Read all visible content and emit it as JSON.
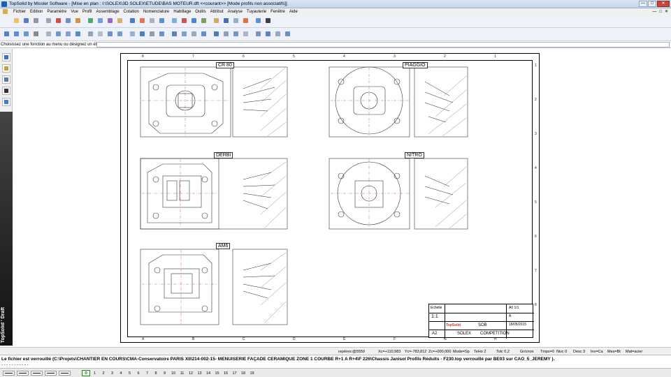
{
  "window": {
    "title": "TopSolid by Missler Software - [Mise en plan : I:\\SOLEX\\3D SOLEX\\ETUDE\\BAS MOTEUR.dft  <<courant>> [Mode profils non associatifs]]",
    "minimize": "—",
    "maximize": "□",
    "close": "✕"
  },
  "menu": {
    "items": [
      "Fichier",
      "Edition",
      "Paramètre",
      "Vue",
      "Profil",
      "Assemblage",
      "Cotation",
      "Nomenclature",
      "Habillage",
      "Outils",
      "Attribut",
      "Analyse",
      "Tuyauterie",
      "Fenêtre",
      "Aide"
    ],
    "right": [
      "—",
      "□",
      "✕"
    ]
  },
  "toolbar1": {
    "colors": [
      "#f2f2f2",
      "#e9b94b",
      "#3c67b8",
      "#7f8793",
      "#8f97a3",
      "#c8322b",
      "#5b7ec8",
      "#c9802a",
      "#2f9b5a",
      "#5e8fd6",
      "#8a4fb8",
      "#d4a64a",
      "#2e6cb5",
      "#e0602d",
      "#a0a8b4",
      "#3f7dd1",
      "#5da4e0",
      "#c23b35",
      "#2a74c4",
      "#6b8d3e",
      "#c5a048",
      "#2c58a5",
      "#8aa0c0",
      "#d95b2b",
      "#3a86c9",
      "#1f1f1f"
    ]
  },
  "toolbar2": {
    "colors": [
      "#2f6fc7",
      "#3d7fd2",
      "#4b8ad6",
      "#777",
      "#9aa7b9",
      "#5b87c5",
      "#6c93cc",
      "#3c78c6",
      "#8297b3",
      "#aab4c4",
      "#4d84c8",
      "#5f8dc9",
      "#8da6c7",
      "#2e6bb6",
      "#7b8fa8",
      "#5582c0",
      "#3f6fb3",
      "#6e8fbf",
      "#8a9cb5",
      "#4a7cc0",
      "#2f64ae",
      "#7a91b3",
      "#5c85bf",
      "#9aaec8",
      "#6383b8",
      "#3b72bd",
      "#8799b2",
      "#5080c3"
    ]
  },
  "prompt": {
    "text": "Choisissez une fonction au menu ou désignez un élément"
  },
  "sidebar": {
    "label": "TopSolid ' Draft"
  },
  "drawing": {
    "views": [
      {
        "label": "CR 80"
      },
      {
        "label": "PIAGGIO"
      },
      {
        "label": "DERBI"
      },
      {
        "label": "NITRO"
      },
      {
        "label": "AM6"
      }
    ],
    "top_ruler": [
      "8",
      "7",
      "6",
      "5",
      "4",
      "3",
      "2",
      "1"
    ],
    "bottom_ruler": [
      "A",
      "B",
      "C",
      "D",
      "E",
      "F",
      "G",
      "H"
    ],
    "side_ruler": [
      "1",
      "2",
      "3",
      "4",
      "5",
      "6",
      "7",
      "8"
    ],
    "titleblock": {
      "scale_label": "Echelle",
      "scale": "1:1",
      "format": "A2",
      "company": "SOLEX",
      "subject": "COMPETITION",
      "logo": "TopSolid",
      "designation": "SOB",
      "date": "18/05/2015",
      "index": "A",
      "sheet": "A0 1/1"
    }
  },
  "status": {
    "reperes": "repères:@5559",
    "x": "Xc=+110,983",
    "y": "Yc=-783,812",
    "z": "Zc=+000,000",
    "mode": "Mode=Sp",
    "tetho": "TeHo 2",
    "tolc": "Tolc 0,2",
    "grid": "Gr/cnon",
    "tmps": "Tmps=0",
    "nivc": "Nivc 0",
    "desc": "Desc 3",
    "inv": "Inv=Ca",
    "mes": "Mes=Bt",
    "mat": "Mat=acier"
  },
  "message": {
    "text": "Le fichier est verrouillé (C:\\Projets\\CHANTIER EN COURS\\CMA-Conservatoire PARIS XII\\214-002-15- MENUISERIE FAÇADE CERAMIQUE ZONE 1 COURBE R+1 A R+4\\F 226\\Chassis Janisol Profils Réduits - F230.top verrouillé par BE03 sur CAO_5_JEREMY ).",
    "dashes": "- - - - - - - - - - -"
  },
  "layers": [
    "0",
    "1",
    "2",
    "3",
    "4",
    "5",
    "6",
    "7",
    "8",
    "9",
    "10",
    "11",
    "12",
    "13",
    "14",
    "15",
    "16",
    "17",
    "18",
    "19"
  ]
}
